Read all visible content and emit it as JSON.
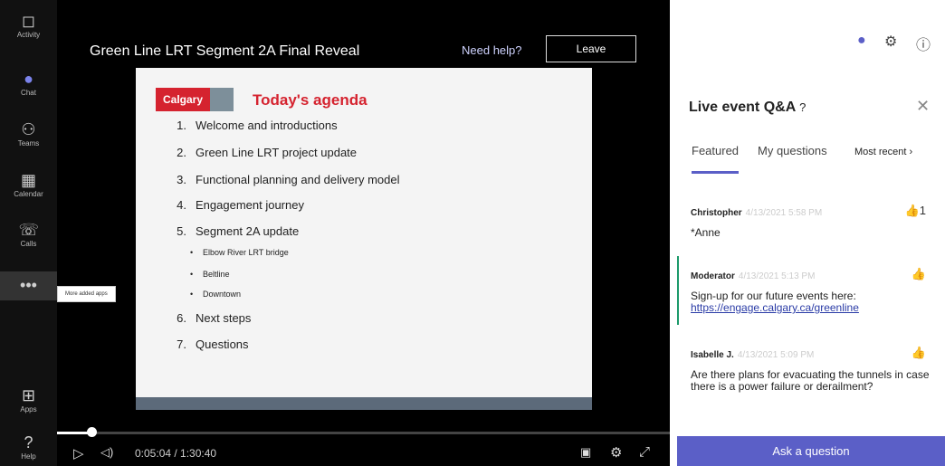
{
  "app_rail": [
    {
      "label": "Activity",
      "icon": "bell-icon"
    },
    {
      "label": "Chat",
      "icon": "chat-icon"
    },
    {
      "label": "Teams",
      "icon": "teams-icon"
    },
    {
      "label": "Calendar",
      "icon": "calendar-icon"
    },
    {
      "label": "Calls",
      "icon": "phone-icon"
    },
    {
      "label": "",
      "icon": "more-icon"
    },
    {
      "label": "Apps",
      "icon": "apps-icon"
    },
    {
      "label": "Help",
      "icon": "help-icon"
    }
  ],
  "tooltip": "More added apps",
  "player": {
    "title": "Green Line LRT Segment 2A Final Reveal",
    "need_help": "Need help?",
    "leave": "Leave",
    "time_display": "0:05:04 / 1:30:40",
    "progress_fraction": 0.056
  },
  "slide": {
    "logo_text": "Calgary",
    "title": "Today's agenda",
    "items": [
      {
        "num": "1.",
        "text": "Welcome and introductions"
      },
      {
        "num": "2.",
        "text": "Green Line LRT project update"
      },
      {
        "num": "3.",
        "text": "Functional planning and delivery model"
      },
      {
        "num": "4.",
        "text": "Engagement journey"
      },
      {
        "num": "5.",
        "text": "Segment 2A update"
      },
      {
        "num": "6.",
        "text": "Next steps"
      },
      {
        "num": "7.",
        "text": "Questions"
      }
    ],
    "subitems": [
      "Elbow River LRT bridge",
      "Beltline",
      "Downtown"
    ]
  },
  "qa": {
    "title": "Live event Q&A",
    "tabs": [
      "Featured",
      "My questions"
    ],
    "sort": "Most recent",
    "ask_button": "Ask a question",
    "questions": [
      {
        "name": "Christopher",
        "stamp": "4/13/2021 5:58 PM",
        "text": "*Anne",
        "likes": "1"
      },
      {
        "name": "Moderator",
        "stamp": "4/13/2021 5:13 PM",
        "text": "Sign-up for our future events here:",
        "link": "https://engage.calgary.ca/greenline"
      },
      {
        "name": "Isabelle J.",
        "stamp": "4/13/2021 5:09 PM",
        "text": "Are there plans for evacuating the tunnels in case there is a power failure or derailment?"
      }
    ]
  },
  "colors": {
    "accent": "#5b5fc7",
    "calgary_red": "#d5232f",
    "moderator_bar": "#1c9a6a"
  }
}
